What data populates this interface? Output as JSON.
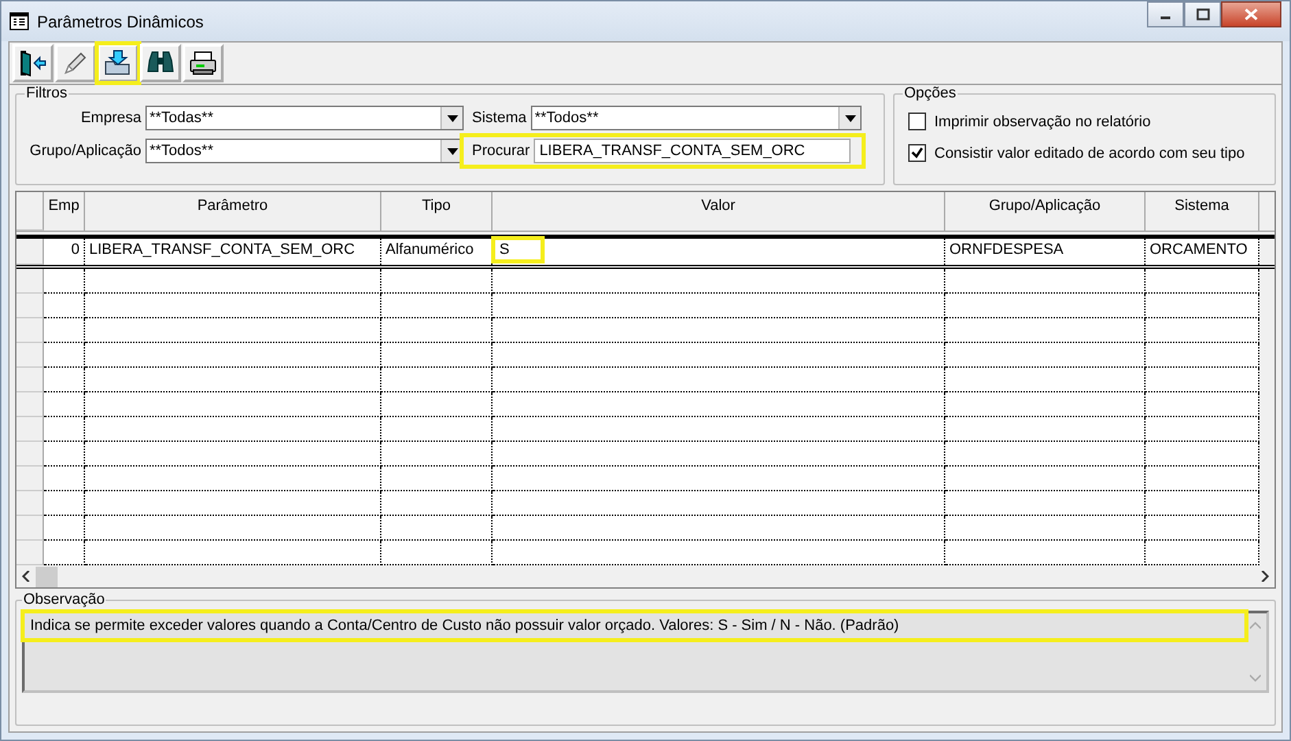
{
  "window": {
    "title": "Parâmetros Dinâmicos"
  },
  "toolbar": [
    {
      "kind": "exit",
      "highlighted": false
    },
    {
      "kind": "edit",
      "highlighted": false
    },
    {
      "kind": "import",
      "highlighted": true
    },
    {
      "kind": "find",
      "highlighted": false
    },
    {
      "kind": "print",
      "highlighted": false
    }
  ],
  "filters": {
    "title": "Filtros",
    "fields": [
      {
        "label": "Empresa",
        "value": "**Todas**",
        "kind": "dropdown",
        "highlighted": false
      },
      {
        "label": "Sistema",
        "value": "**Todos**",
        "kind": "dropdown",
        "highlighted": false
      },
      {
        "label": "Grupo/Aplicação",
        "value": "**Todos**",
        "kind": "dropdown",
        "highlighted": false
      },
      {
        "label": "Procurar",
        "value": "LIBERA_TRANSF_CONTA_SEM_ORC",
        "kind": "text",
        "highlighted": true
      }
    ]
  },
  "options": {
    "title": "Opções",
    "items": [
      {
        "label": "Imprimir observação no relatório",
        "checked": false
      },
      {
        "label": "Consistir valor editado de acordo com seu tipo",
        "checked": true
      }
    ]
  },
  "table": {
    "columns": [
      "Emp",
      "Parâmetro",
      "Tipo",
      "Valor",
      "Grupo/Aplicação",
      "Sistema"
    ],
    "rows": [
      {
        "selected": true,
        "cells": [
          {
            "text": "0",
            "highlighted": false
          },
          {
            "text": "LIBERA_TRANSF_CONTA_SEM_ORC",
            "highlighted": false
          },
          {
            "text": "Alfanumérico",
            "highlighted": false
          },
          {
            "text": "S",
            "highlighted": true
          },
          {
            "text": "ORNFDESPESA",
            "highlighted": false
          },
          {
            "text": "ORCAMENTO",
            "highlighted": false
          }
        ]
      }
    ]
  },
  "observation": {
    "title": "Observação",
    "text": "Indica se permite exceder valores quando a Conta/Centro de Custo não possuir valor orçado. Valores: S - Sim / N - Não. (Padrão)",
    "highlighted": true
  }
}
